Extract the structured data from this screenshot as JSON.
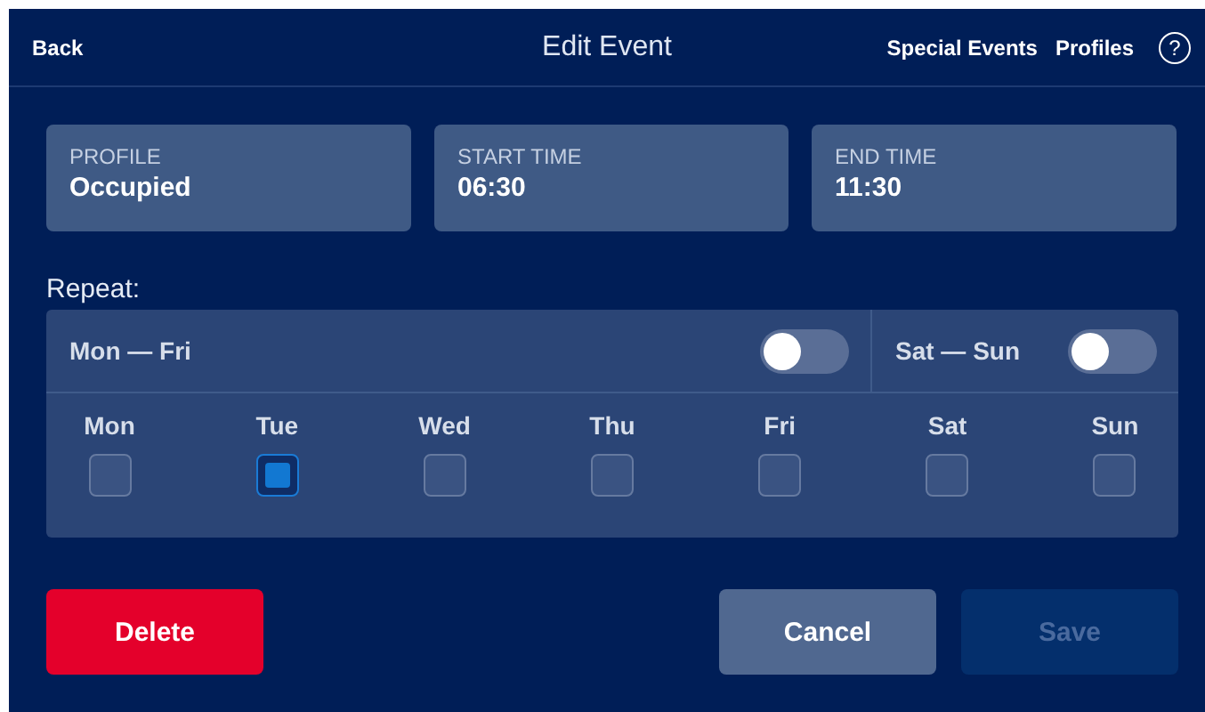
{
  "header": {
    "back": "Back",
    "title": "Edit Event",
    "links": [
      "Special Events",
      "Profiles"
    ],
    "help": "?"
  },
  "fields": [
    {
      "label": "PROFILE",
      "value": "Occupied"
    },
    {
      "label": "START TIME",
      "value": "06:30"
    },
    {
      "label": "END TIME",
      "value": "11:30"
    }
  ],
  "repeat": {
    "label": "Repeat:",
    "toggles": [
      {
        "label": "Mon — Fri",
        "on": false
      },
      {
        "label": "Sat — Sun",
        "on": false
      }
    ],
    "days": [
      {
        "label": "Mon",
        "checked": false
      },
      {
        "label": "Tue",
        "checked": true
      },
      {
        "label": "Wed",
        "checked": false
      },
      {
        "label": "Thu",
        "checked": false
      },
      {
        "label": "Fri",
        "checked": false
      },
      {
        "label": "Sat",
        "checked": false
      },
      {
        "label": "Sun",
        "checked": false
      }
    ]
  },
  "buttons": [
    {
      "label": "Delete",
      "kind": "danger",
      "disabled": false
    },
    {
      "label": "Cancel",
      "kind": "secondary",
      "disabled": false
    },
    {
      "label": "Save",
      "kind": "primary",
      "disabled": true
    }
  ]
}
